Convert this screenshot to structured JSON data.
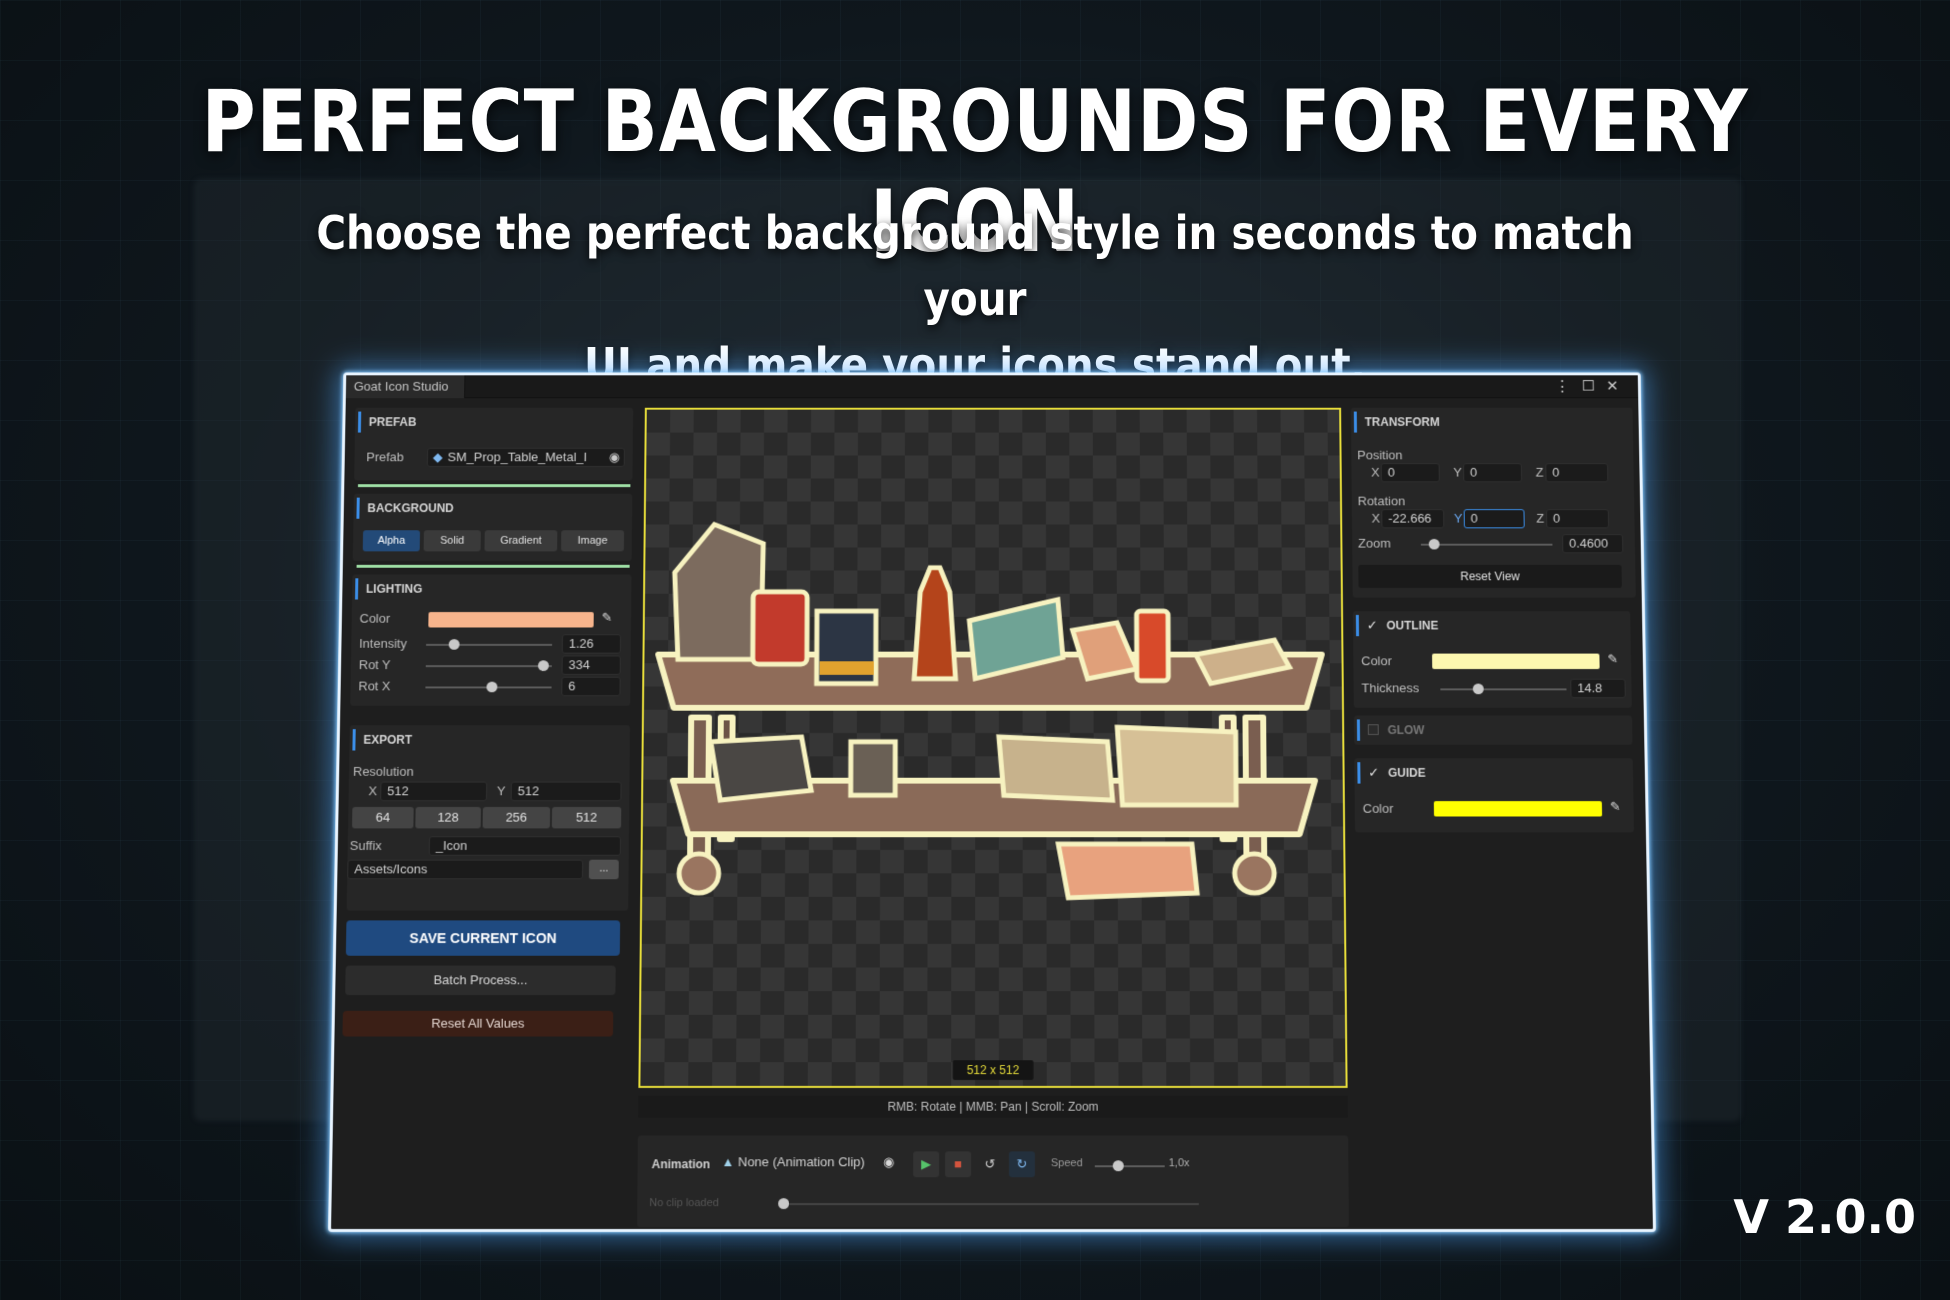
{
  "marketing": {
    "headline": "PERFECT BACKGROUNDS FOR EVERY ICON",
    "subline_1": "Choose the perfect background style in seconds to match your",
    "subline_2": "UI and make your icons stand out.",
    "version": "V 2.0.0"
  },
  "window": {
    "tab_title": "Goat Icon Studio",
    "controls": [
      "more-vertical-icon",
      "maximize-icon",
      "close-icon"
    ]
  },
  "prefab": {
    "title": "PREFAB",
    "label": "Prefab",
    "value": "SM_Prop_Table_Metal_I"
  },
  "background": {
    "title": "BACKGROUND",
    "modes": [
      "Alpha",
      "Solid",
      "Gradient",
      "Image"
    ],
    "active": "Alpha"
  },
  "lighting": {
    "title": "LIGHTING",
    "color_label": "Color",
    "color": "#f7b48c",
    "intensity_label": "Intensity",
    "intensity": "1.26",
    "intensity_level": 0.22,
    "roty_label": "Rot Y",
    "roty": "334",
    "roty_level": 0.93,
    "rotx_label": "Rot X",
    "rotx": "6",
    "rotx_level": 0.52
  },
  "export": {
    "title": "EXPORT",
    "resolution_label": "Resolution",
    "x_label": "X",
    "x": "512",
    "y_label": "Y",
    "y": "512",
    "presets": [
      "64",
      "128",
      "256",
      "512"
    ],
    "suffix_label": "Suffix",
    "suffix": "_Icon",
    "path": "Assets/Icons",
    "browse": "...",
    "save": "SAVE CURRENT ICON",
    "batch": "Batch Process...",
    "reset": "Reset All Values"
  },
  "viewport": {
    "resolution_badge": "512 x 512",
    "hints": "RMB: Rotate   |   MMB: Pan   |   Scroll: Zoom"
  },
  "animation": {
    "label": "Animation",
    "clip": "None (Animation Clip)",
    "speed_label": "Speed",
    "speed": "1,0x",
    "speed_level": 0.33,
    "status": "No clip loaded"
  },
  "transform": {
    "title": "TRANSFORM",
    "position_label": "Position",
    "pos_x": "0",
    "pos_y": "0",
    "pos_z": "0",
    "rotation_label": "Rotation",
    "rot_x": "-22.666",
    "rot_y": "0",
    "rot_z": "0",
    "zoom_label": "Zoom",
    "zoom": "0.4600",
    "zoom_level": 0.1,
    "reset_view": "Reset View",
    "axis_x": "X",
    "axis_y": "Y",
    "axis_z": "Z"
  },
  "outline": {
    "title": "OUTLINE",
    "enabled": true,
    "color_label": "Color",
    "color": "#fdf8b0",
    "thickness_label": "Thickness",
    "thickness": "14.8",
    "thickness_level": 0.3
  },
  "glow": {
    "title": "GLOW",
    "enabled": false
  },
  "guide": {
    "title": "GUIDE",
    "enabled": true,
    "color_label": "Color",
    "color": "#ffff00"
  }
}
